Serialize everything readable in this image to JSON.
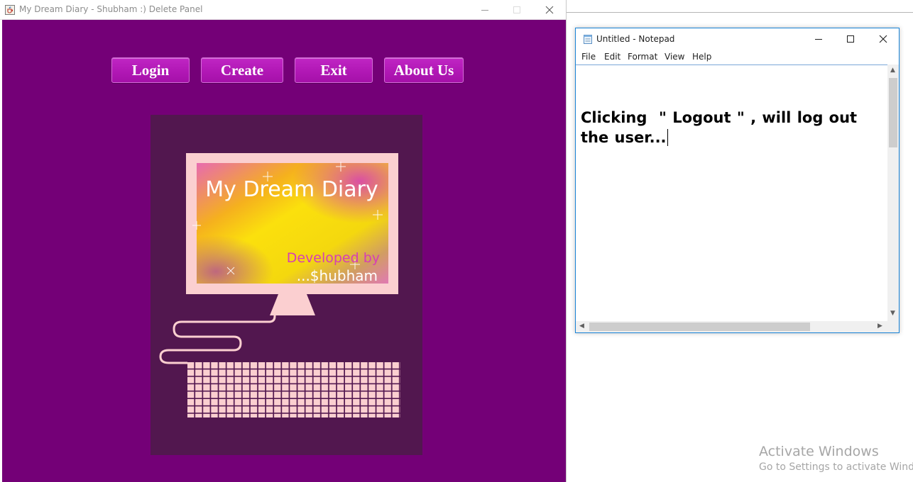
{
  "java_window": {
    "title": "My Dream Diary - Shubham :) Delete Panel",
    "background_color": "#740077",
    "nav_buttons": [
      {
        "label": "Login"
      },
      {
        "label": "Create"
      },
      {
        "label": "Exit"
      },
      {
        "label": "About Us"
      }
    ],
    "illustration": {
      "screen_title": "My Dream Diary",
      "credit_line1": "Developed by",
      "credit_line2": "...$hubham",
      "panel_color": "#52174f",
      "monitor_color": "#fbcfd0",
      "credit_color": "#d63fb4"
    }
  },
  "notepad": {
    "title": "Untitled - Notepad",
    "menu": [
      "File",
      "Edit",
      "Format",
      "View",
      "Help"
    ],
    "text": "Clicking  \" Logout \" , will log out the user..."
  },
  "watermark": {
    "title": "Activate Windows",
    "subtitle": "Go to Settings to activate Windows."
  }
}
